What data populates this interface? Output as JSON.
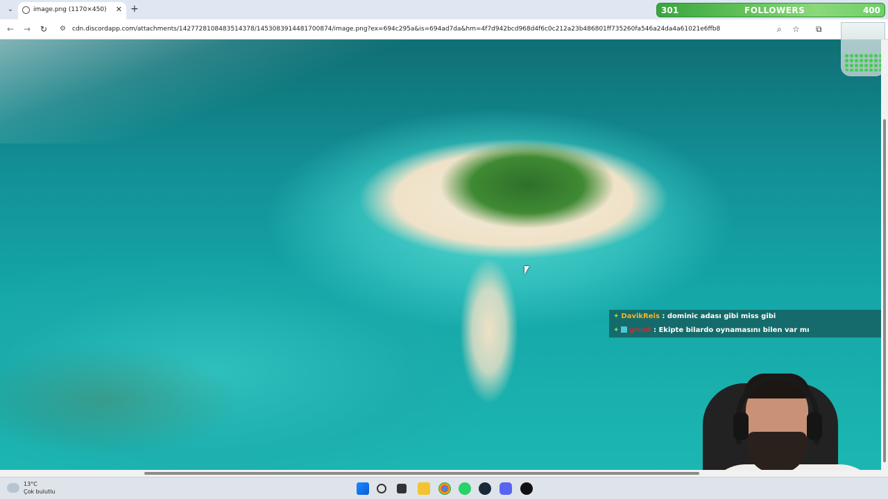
{
  "browser": {
    "tab_title": "image.png (1170×450)",
    "url": "cdn.discordapp.com/attachments/1427728108483514378/1453083914481700874/image.png?ex=694c295a&is=694ad7da&hm=4f7d942bcd968d4f6c0c212a23b486801ff735260fa546a24da4a61021e6ffb8"
  },
  "overlay": {
    "followers_count": "301",
    "followers_label": "FOLLOWERS",
    "followers_goal": "400",
    "followers_progress": 0.7525
  },
  "chat": [
    {
      "user": "DavikReis",
      "message": ": dominic adası gibi miss gibi"
    },
    {
      "user": "grunt",
      "message": ": Ekipte bilardo oynamasını bilen var mı"
    }
  ],
  "taskbar": {
    "temperature": "13°C",
    "condition": "Çok bulutlu"
  },
  "colors": {
    "followers_bar": "#64c25a",
    "chat_user1": "#f5b52a",
    "chat_user2": "#d02a2a"
  }
}
